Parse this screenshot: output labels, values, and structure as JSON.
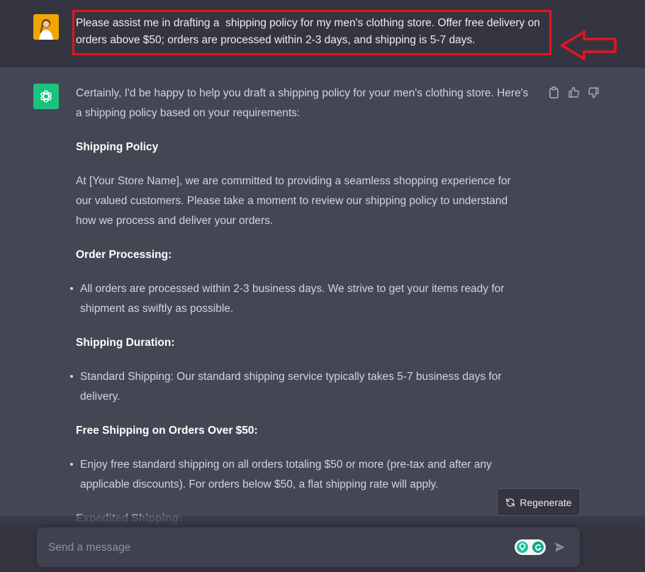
{
  "user_message": {
    "text": "Please assist me in drafting a  shipping policy for my men's clothing store. Offer free delivery on orders above $50; orders are processed within 2-3 days, and shipping is 5-7 days."
  },
  "assistant_message": {
    "intro": "Certainly, I'd be happy to help you draft a shipping policy for your men's clothing store. Here's a shipping policy based on your requirements:",
    "heading": "Shipping Policy",
    "paragraph": "At [Your Store Name], we are committed to providing a seamless shopping experience for our valued customers. Please take a moment to review our shipping policy to understand how we process and deliver your orders.",
    "sections": [
      {
        "title": "Order Processing:",
        "bullet": "All orders are processed within 2-3 business days. We strive to get your items ready for shipment as swiftly as possible."
      },
      {
        "title": "Shipping Duration:",
        "bullet": "Standard Shipping: Our standard shipping service typically takes 5-7 business days for delivery."
      },
      {
        "title": "Free Shipping on Orders Over $50:",
        "bullet": "Enjoy free standard shipping on all orders totaling $50 or more (pre-tax and after any applicable discounts). For orders below $50, a flat shipping rate will apply."
      }
    ],
    "faded_heading": "Expedited Shipping:"
  },
  "icons": {
    "copy": "clipboard-icon",
    "like": "thumbs-up-icon",
    "dislike": "thumbs-down-icon",
    "regenerate": "refresh-icon",
    "send": "send-icon"
  },
  "regenerate_label": "Regenerate",
  "composer": {
    "placeholder": "Send a message"
  },
  "colors": {
    "highlight": "#e3161d",
    "accent": "#19c37d",
    "user_bg": "#343541",
    "assistant_bg": "#444654"
  }
}
